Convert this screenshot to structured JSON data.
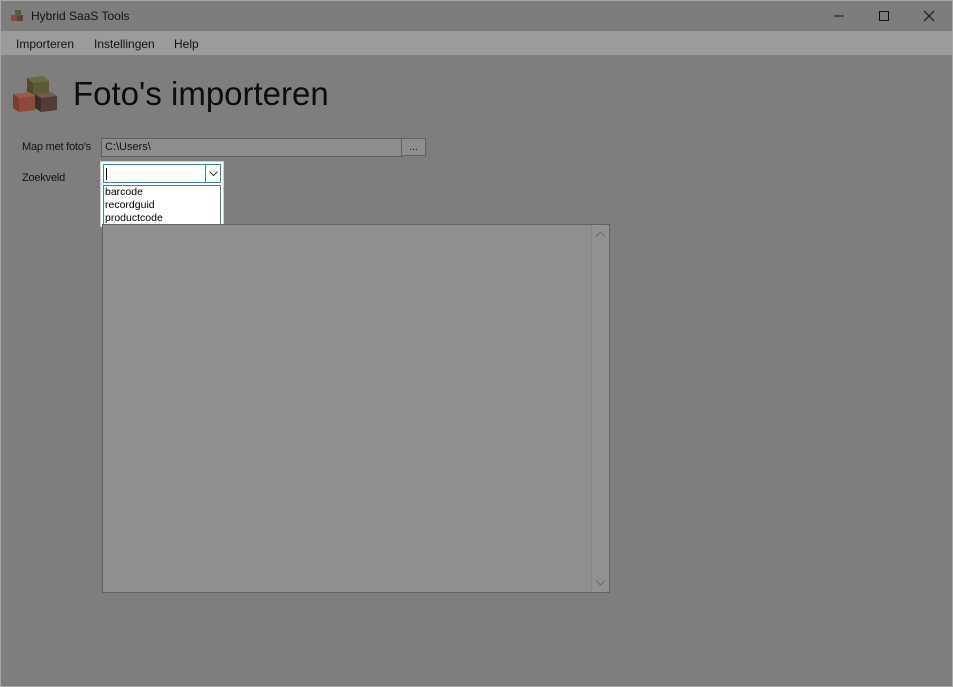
{
  "window": {
    "title": "Hybrid SaaS Tools",
    "controls": {
      "minimize": "minimize-icon",
      "maximize": "maximize-icon",
      "close": "close-icon"
    }
  },
  "menu": {
    "items": [
      {
        "label": "Importeren"
      },
      {
        "label": "Instellingen"
      },
      {
        "label": "Help"
      }
    ]
  },
  "page": {
    "title": "Foto's importeren",
    "icon": "boxes-icon"
  },
  "form": {
    "folder_label": "Map met foto's",
    "folder_value": "C:\\Users\\",
    "browse_label": "...",
    "search_field_label": "Zoekveld",
    "search_field_value": "",
    "search_field_options": [
      "barcode",
      "recordguid",
      "productcode"
    ]
  },
  "colors": {
    "overlay": "#7e7e7e",
    "accent": "#3c7fb1"
  }
}
